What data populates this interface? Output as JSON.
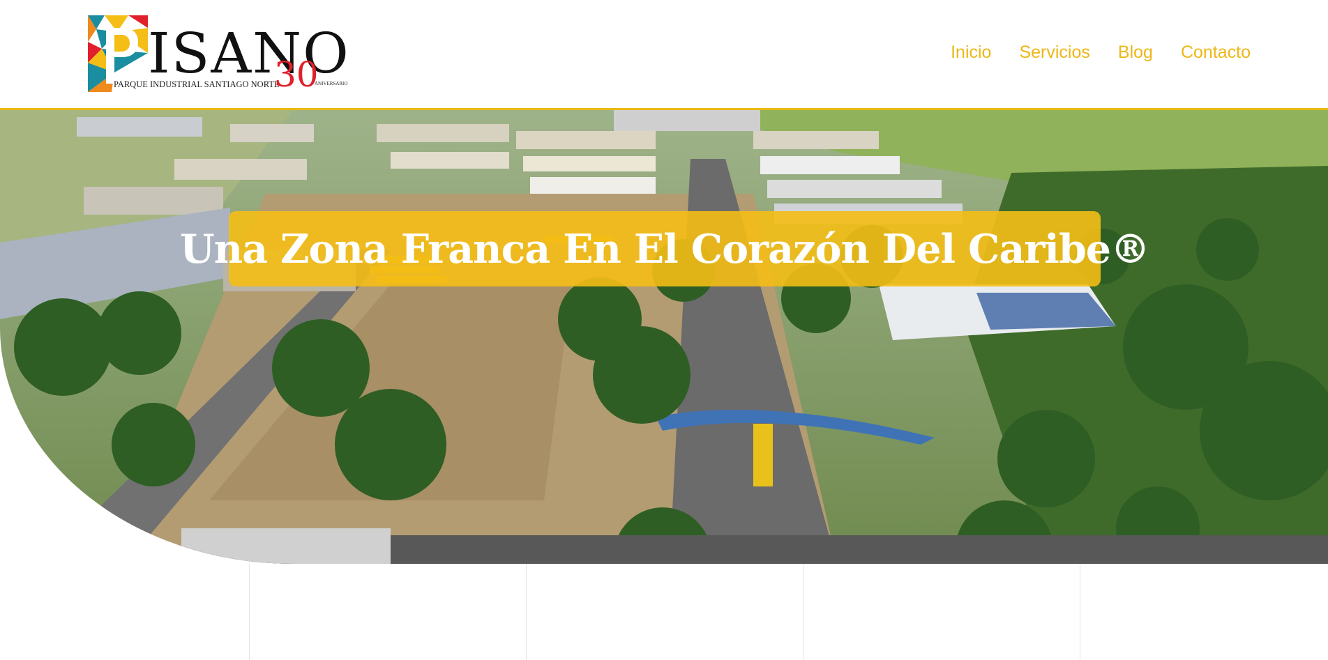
{
  "brand": {
    "logo_word": "ISANO",
    "logo_subtitle": "PARQUE INDUSTRIAL SANTIAGO NORTE",
    "anniversary_number": "30",
    "anniversary_label": "ANIVERSARIO",
    "colors": {
      "yellow": "#f4be16",
      "teal": "#1a8ea0",
      "red": "#e0202a",
      "orange": "#f08a1c"
    }
  },
  "nav": {
    "items": [
      {
        "label": "Inicio"
      },
      {
        "label": "Servicios"
      },
      {
        "label": "Blog"
      },
      {
        "label": "Contacto"
      }
    ],
    "color": "#ecb718"
  },
  "hero": {
    "headline": "Una Zona Franca En El Corazón Del Caribe®",
    "image": "aerial-view-industrial-park"
  }
}
